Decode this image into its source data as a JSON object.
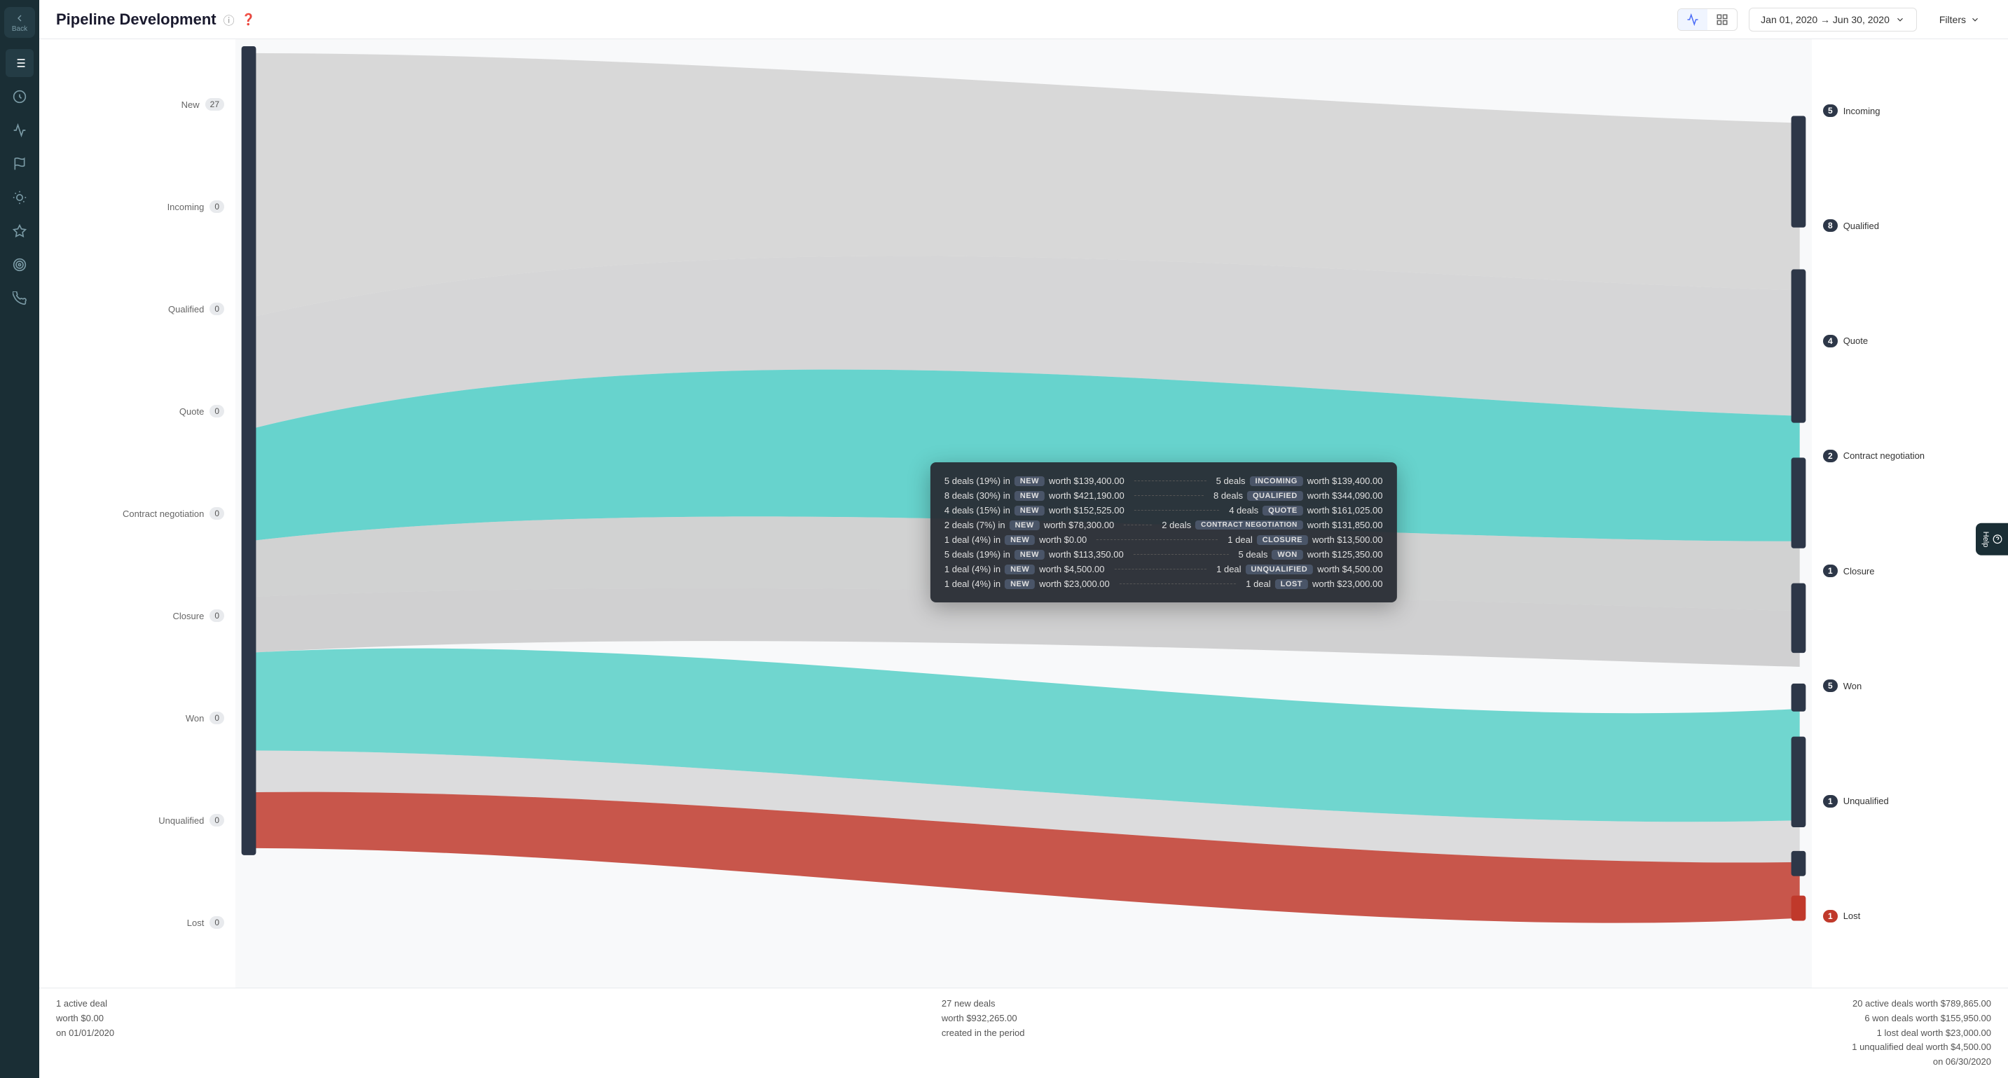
{
  "app": {
    "back_label": "Back",
    "title": "Pipeline Development",
    "date_range": "Jan 01, 2020 → Jun 30, 2020",
    "filters_label": "Filters"
  },
  "left_labels": [
    {
      "name": "New",
      "count": "27"
    },
    {
      "name": "Incoming",
      "count": "0"
    },
    {
      "name": "Qualified",
      "count": "0"
    },
    {
      "name": "Quote",
      "count": "0"
    },
    {
      "name": "Contract negotiation",
      "count": "0"
    },
    {
      "name": "Closure",
      "count": "0"
    },
    {
      "name": "Won",
      "count": "0"
    },
    {
      "name": "Unqualified",
      "count": "0"
    },
    {
      "name": "Lost",
      "count": "0"
    }
  ],
  "right_labels": [
    {
      "name": "Incoming",
      "count": "5"
    },
    {
      "name": "Qualified",
      "count": "8"
    },
    {
      "name": "Quote",
      "count": "4"
    },
    {
      "name": "Contract negotiation",
      "count": "2"
    },
    {
      "name": "Closure",
      "count": "1"
    },
    {
      "name": "Won",
      "count": "5"
    },
    {
      "name": "Unqualified",
      "count": "1"
    },
    {
      "name": "Lost",
      "count": "1"
    }
  ],
  "tooltip": {
    "rows": [
      {
        "left_count": "5 deals (19%) in",
        "left_badge": "NEW",
        "left_badge_class": "badge-new",
        "left_worth": "worth $139,400.00",
        "right_count": "5 deals",
        "right_badge": "INCOMING",
        "right_badge_class": "badge-incoming",
        "right_worth": "worth $139,400.00"
      },
      {
        "left_count": "8 deals (30%) in",
        "left_badge": "NEW",
        "left_badge_class": "badge-new",
        "left_worth": "worth $421,190.00",
        "right_count": "8 deals",
        "right_badge": "QUALIFIED",
        "right_badge_class": "badge-qualified",
        "right_worth": "worth $344,090.00"
      },
      {
        "left_count": "4 deals (15%) in",
        "left_badge": "NEW",
        "left_badge_class": "badge-new",
        "left_worth": "worth $152,525.00",
        "right_count": "4 deals",
        "right_badge": "QUOTE",
        "right_badge_class": "badge-quote",
        "right_worth": "worth $161,025.00"
      },
      {
        "left_count": "2 deals (7%) in",
        "left_badge": "NEW",
        "left_badge_class": "badge-new",
        "left_worth": "worth $78,300.00",
        "right_count": "2 deals",
        "right_badge": "CONTRACT NEGOTIATION",
        "right_badge_class": "badge-contract",
        "right_worth": "worth $131,850.00"
      },
      {
        "left_count": "1 deal (4%) in",
        "left_badge": "NEW",
        "left_badge_class": "badge-new",
        "left_worth": "worth $0.00",
        "right_count": "1 deal",
        "right_badge": "CLOSURE",
        "right_badge_class": "badge-closure",
        "right_worth": "worth $13,500.00"
      },
      {
        "left_count": "5 deals (19%) in",
        "left_badge": "NEW",
        "left_badge_class": "badge-new",
        "left_worth": "worth $113,350.00",
        "right_count": "5 deals",
        "right_badge": "WON",
        "right_badge_class": "badge-won",
        "right_worth": "worth $125,350.00"
      },
      {
        "left_count": "1 deal (4%) in",
        "left_badge": "NEW",
        "left_badge_class": "badge-new",
        "left_worth": "worth $4,500.00",
        "right_count": "1 deal",
        "right_badge": "UNQUALIFIED",
        "right_badge_class": "badge-unqualified",
        "right_worth": "worth $4,500.00"
      },
      {
        "left_count": "1 deal (4%) in",
        "left_badge": "NEW",
        "left_badge_class": "badge-new",
        "left_worth": "worth $23,000.00",
        "right_count": "1 deal",
        "right_badge": "LOST",
        "right_badge_class": "badge-lost",
        "right_worth": "worth $23,000.00"
      }
    ]
  },
  "footer": {
    "left1": "1 active deal",
    "left2": "worth $0.00",
    "left3": "on 01/01/2020",
    "center1": "27 new deals",
    "center2": "worth $932,265.00",
    "center3": "created in the period",
    "right1": "20 active deals worth $789,865.00",
    "right2": "6 won deals worth $155,950.00",
    "right3": "1 lost deal worth $23,000.00",
    "right4": "1 unqualified deal worth $4,500.00",
    "right5": "on 06/30/2020"
  }
}
